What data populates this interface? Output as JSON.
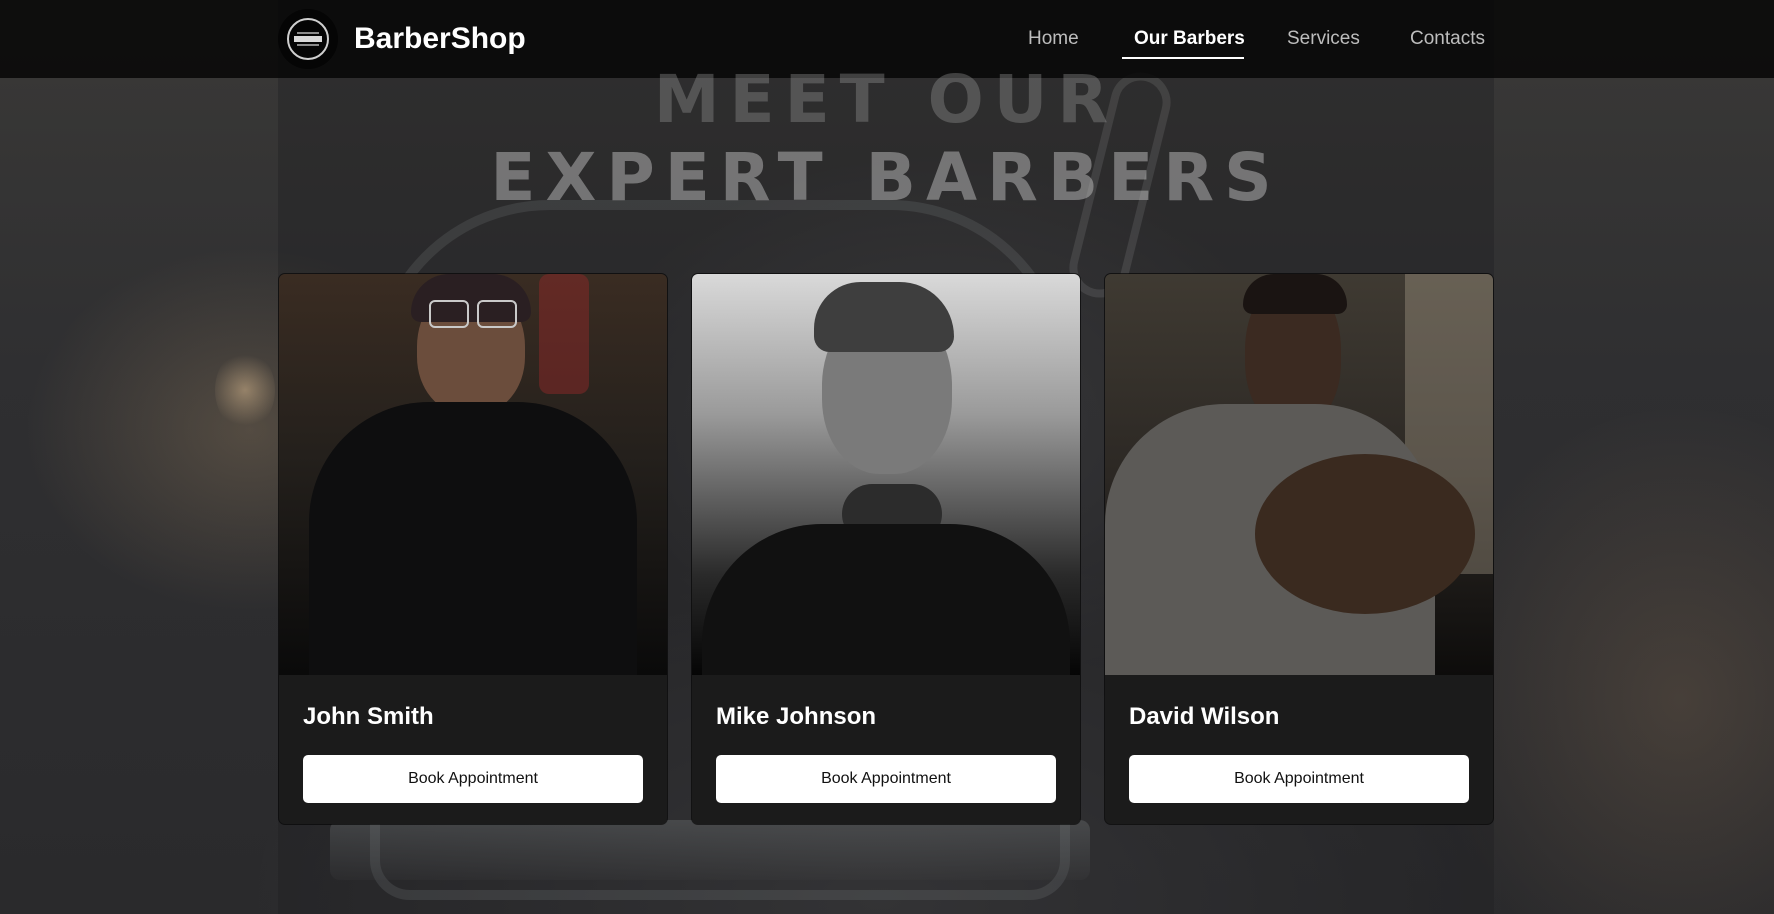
{
  "header": {
    "brand": "BarberShop",
    "logo_icon": "barbershop-logo-icon",
    "nav": [
      {
        "label": "Home",
        "active": false
      },
      {
        "label": "Our Barbers",
        "active": true
      },
      {
        "label": "Services",
        "active": false
      },
      {
        "label": "Contacts",
        "active": false
      }
    ]
  },
  "hero": {
    "line1": "MEET OUR",
    "line2": "EXPERT BARBERS"
  },
  "barbers": [
    {
      "name": "John Smith",
      "button": "Book Appointment"
    },
    {
      "name": "Mike Johnson",
      "button": "Book Appointment"
    },
    {
      "name": "David Wilson",
      "button": "Book Appointment"
    }
  ],
  "colors": {
    "header_bg": "#080808",
    "card_bg": "#1b1b1b",
    "button_bg": "#ffffff",
    "text_primary": "#ffffff",
    "nav_inactive": "#bdbdbd"
  }
}
